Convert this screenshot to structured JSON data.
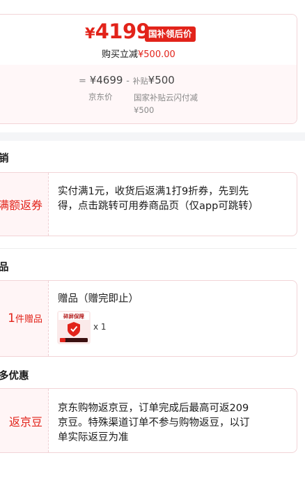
{
  "price": {
    "currency": "¥",
    "amount": "4199",
    "tag": "国补领后价",
    "reduce_label": "购买立减",
    "reduce_value": "¥500.00"
  },
  "breakdown": {
    "equals": "=",
    "jd_price": "¥4699",
    "minus": "-",
    "subsidy_prefix": "补贴",
    "subsidy_value": "¥500",
    "jd_price_caption": "京东价",
    "subsidy_caption": "国家补贴云闪付减¥500"
  },
  "sections": [
    {
      "title": "销",
      "label": "满额返券",
      "desc": "实付满1元，收货后返满1打9折券，先到先得，点击跳转可用券商品页（仅app可跳转）"
    },
    {
      "title": "品",
      "label_num": "1",
      "label_unit": "件赠品",
      "desc": "赠品（赠完即止）",
      "gift": {
        "image_text": "碎屏保障",
        "qty": "x 1"
      }
    },
    {
      "title": "多优惠",
      "label": "返京豆",
      "desc": "京东购物返京豆，订单完成后最高可返209京豆。特殊渠道订单不参与购物返豆，以订单实际返豆为准"
    }
  ],
  "colors": {
    "accent": "#e2231a",
    "card_border": "#f2d4d7",
    "card_bg": "#fff5f6"
  }
}
